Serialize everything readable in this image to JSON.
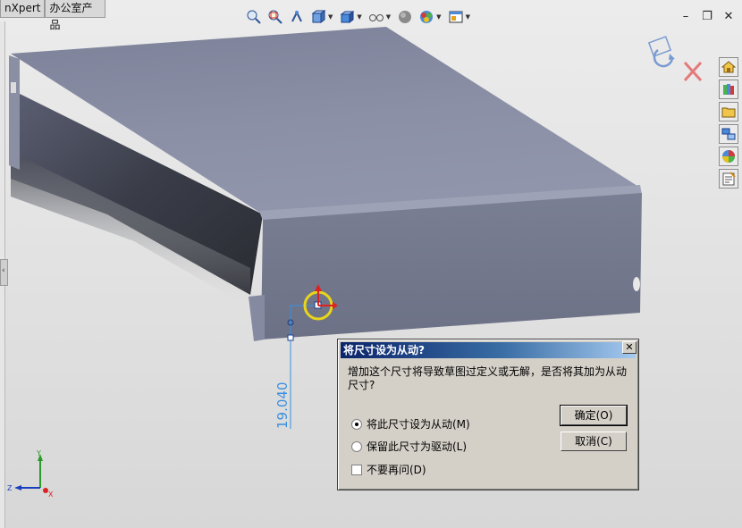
{
  "top_tabs": [
    "nXpert",
    "办公室产品"
  ],
  "toolbar_icons": [
    "zoom-to-fit-icon",
    "zoom-area-icon",
    "previous-view-icon",
    "section-view-icon",
    "view-orientation-icon",
    "display-style-icon",
    "hide-show-items-icon",
    "edit-appearance-icon",
    "apply-scene-icon",
    "view-settings-icon"
  ],
  "window_controls": {
    "minimize": "–",
    "restore": "❐",
    "close": "✕"
  },
  "dimension": {
    "value": "19.040"
  },
  "triad": {
    "x": "X",
    "y": "Y",
    "z": "Z"
  },
  "dialog": {
    "title": "将尺寸设为从动?",
    "close": "✕",
    "message": "增加这个尺寸将导致草图过定义或无解，是否将其加为从动尺寸?",
    "option_driven": "将此尺寸设为从动(M)",
    "option_driving": "保留此尺寸为驱动(L)",
    "no_ask_again": "不要再问(D)",
    "ok": "确定(O)",
    "cancel": "取消(C)"
  },
  "colors": {
    "model_top": "#8d92a8",
    "model_side": "#72778c",
    "dimension": "#3a8fe0",
    "title_bar": "#0a246a"
  }
}
